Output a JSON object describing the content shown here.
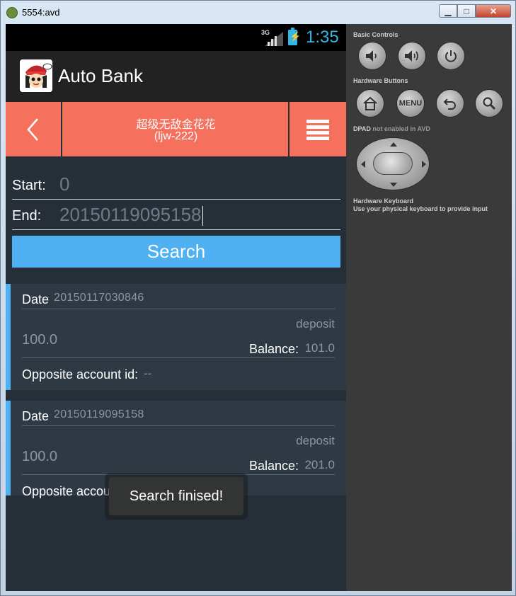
{
  "window": {
    "title": "5554:avd",
    "min_label": "▁",
    "max_label": "□",
    "close_label": "✕"
  },
  "statusbar": {
    "network": "3G",
    "time": "1:35"
  },
  "actionbar": {
    "title": "Auto Bank",
    "icon": "app-avatar-icon"
  },
  "header": {
    "name": "超级无敌金花花",
    "sub": "(ljw-222)",
    "back_icon": "chevron-left-icon",
    "menu_icon": "hamburger-menu-icon"
  },
  "form": {
    "start_label": "Start:",
    "start_value": "0",
    "end_label": "End:",
    "end_value": "20150119095158",
    "search_label": "Search"
  },
  "transactions": [
    {
      "date_label": "Date",
      "date": "20150117030846",
      "type": "deposit",
      "amount": "100.0",
      "balance_label": "Balance:",
      "balance": "101.0",
      "opp_label": "Opposite account id:",
      "opp_value": "--"
    },
    {
      "date_label": "Date",
      "date": "20150119095158",
      "type": "deposit",
      "amount": "100.0",
      "balance_label": "Balance:",
      "balance": "201.0",
      "opp_label": "Opposite account id:",
      "opp_value": ""
    }
  ],
  "toast": {
    "text": "Search finised!"
  },
  "side_panel": {
    "basic_controls": "Basic Controls",
    "hardware_buttons": "Hardware Buttons",
    "menu_label": "MENU",
    "dpad_label": "DPAD",
    "dpad_note": " not enabled in AVD",
    "keyboard_title": "Hardware Keyboard",
    "keyboard_note": "Use your physical keyboard to provide input"
  },
  "colors": {
    "accent_header": "#f6705e",
    "accent_blue": "#4fb0f2",
    "status_time": "#33b5e5",
    "background": "#262e38"
  }
}
